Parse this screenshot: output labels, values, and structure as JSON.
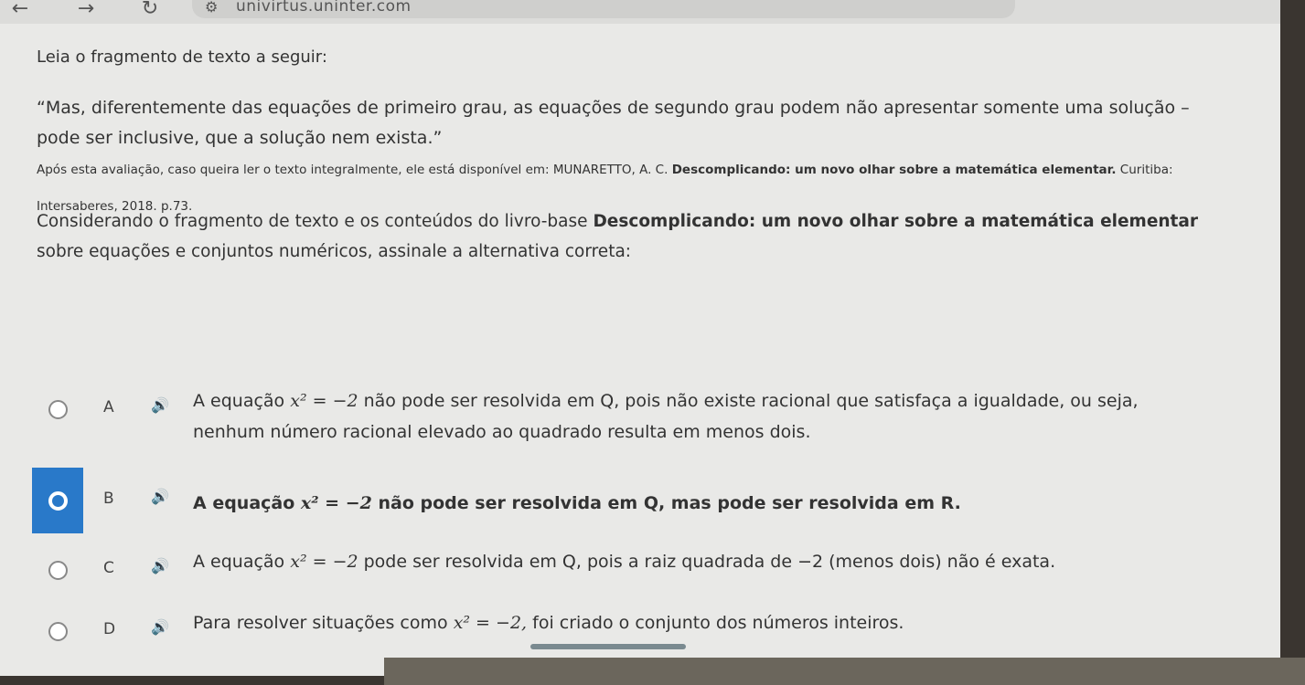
{
  "browser": {
    "url": "univirtus.uninter.com"
  },
  "question": {
    "intro": "Leia o fragmento de texto a seguir:",
    "quote": "“Mas, diferentemente das equações de primeiro grau, as equações de segundo grau podem não apresentar somente uma solução – pode ser inclusive, que a solução nem exista.”",
    "reference_prefix": "Após esta avaliação, caso queira ler o texto integralmente, ele está disponível em: MUNARETTO, A. C.",
    "reference_book": "Descomplicando: um novo olhar sobre a matemática elementar.",
    "reference_suffix": "Curitiba: Intersaberes, 2018. p.73.",
    "prompt_prefix": "Considerando o fragmento de texto e os conteúdos do livro-base",
    "prompt_book": "Descomplicando: um novo olhar sobre a matemática elementar",
    "prompt_suffix": "sobre equações e conjuntos numéricos, assinale a alternativa correta:"
  },
  "alternatives": [
    {
      "letter": "A",
      "pre": "A equação",
      "math": "x² = −2",
      "post": "não pode ser resolvida em Q, pois não existe racional que satisfaça a igualdade, ou seja, nenhum número racional elevado ao quadrado resulta em menos dois.",
      "selected": false
    },
    {
      "letter": "B",
      "pre": "A equação",
      "math": "x² = −2",
      "post": "não pode ser resolvida em Q, mas pode ser resolvida em R.",
      "selected": true
    },
    {
      "letter": "C",
      "pre": "A equação",
      "math": "x² = −2",
      "post": "pode ser resolvida em Q, pois a raiz quadrada de −2 (menos dois) não é exata.",
      "selected": false
    },
    {
      "letter": "D",
      "pre": "Para resolver situações como",
      "math": "x² = −2,",
      "post": "foi criado o conjunto dos números inteiros.",
      "selected": false
    }
  ],
  "colors": {
    "selected": "#2979c9",
    "page_bg": "#e9e9e7"
  },
  "icons": {
    "back": "arrow-left-icon",
    "forward": "arrow-right-icon",
    "reload": "reload-icon",
    "site_settings": "tune-icon",
    "speaker": "speaker-icon"
  }
}
